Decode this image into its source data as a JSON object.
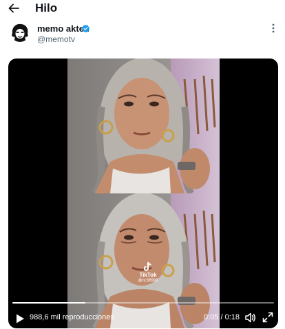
{
  "header": {
    "title": "Hilo",
    "back_icon": "arrow-left-icon"
  },
  "author": {
    "display_name": "memo akten",
    "handle": "@memotv",
    "verified_color": "#1d9bf0",
    "more_icon": "more-vertical-icon"
  },
  "video": {
    "views": "988,6 mil reproducciones",
    "time": "0:05 / 0:18",
    "progress_fraction": 0.28,
    "watermark": {
      "brand": "TikTok",
      "user": "@nc36998"
    },
    "icons": {
      "play": "play-icon",
      "volume": "volume-icon",
      "fullscreen": "fullscreen-icon"
    }
  },
  "colors": {
    "text": "#0f1419",
    "secondary": "#536471",
    "video_bg": "#000000",
    "verified": "#1d9bf0"
  }
}
